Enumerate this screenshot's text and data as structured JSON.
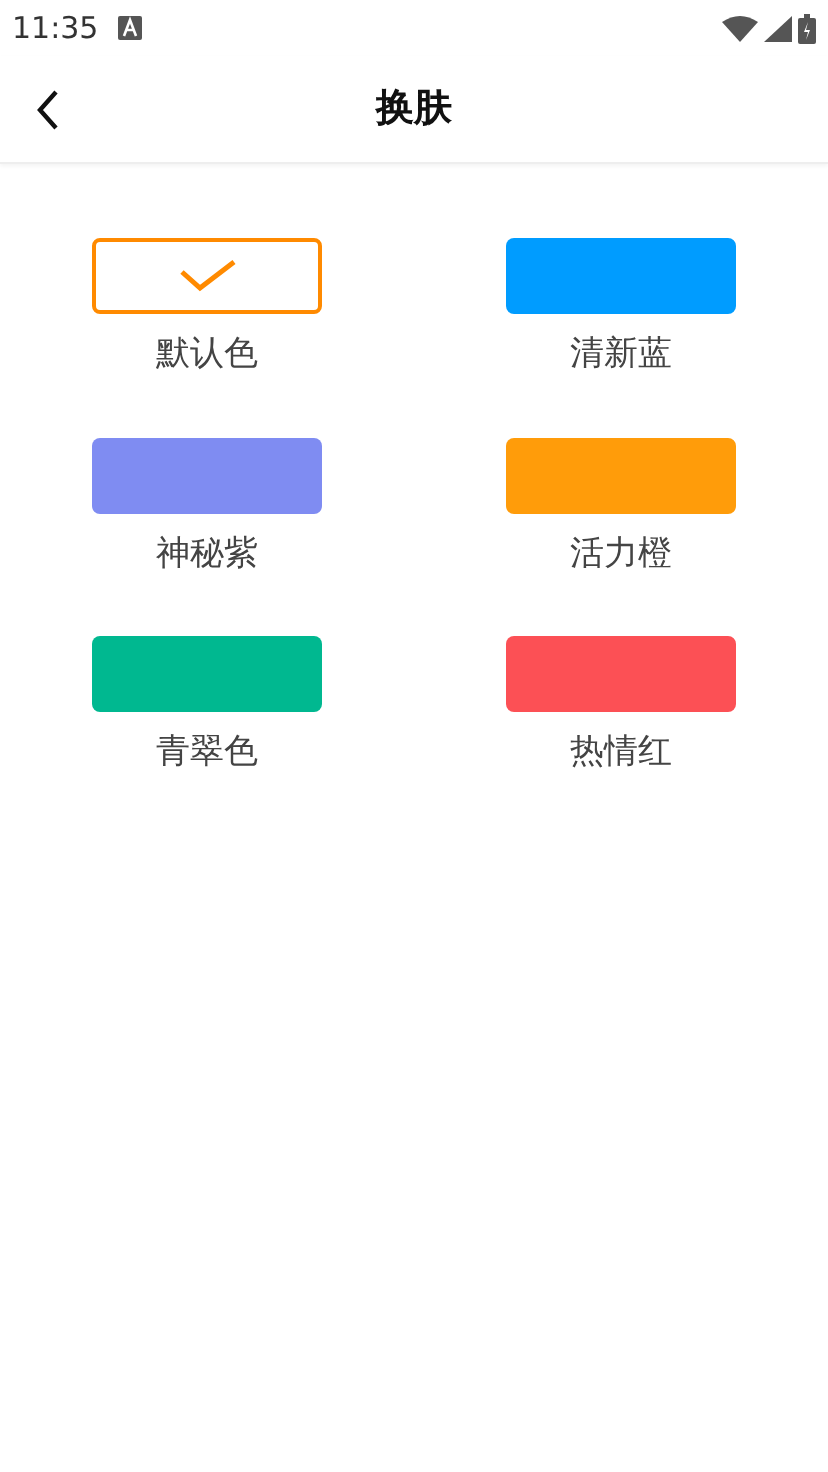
{
  "status_bar": {
    "time": "11:35"
  },
  "header": {
    "title": "换肤"
  },
  "themes": [
    {
      "label": "默认色",
      "color": "#ff8a00",
      "selected": true
    },
    {
      "label": "清新蓝",
      "color": "#009cff",
      "selected": false
    },
    {
      "label": "神秘紫",
      "color": "#7f8cf2",
      "selected": false
    },
    {
      "label": "活力橙",
      "color": "#ff9c0a",
      "selected": false
    },
    {
      "label": "青翠色",
      "color": "#00b890",
      "selected": false
    },
    {
      "label": "热情红",
      "color": "#fc5055",
      "selected": false
    }
  ]
}
